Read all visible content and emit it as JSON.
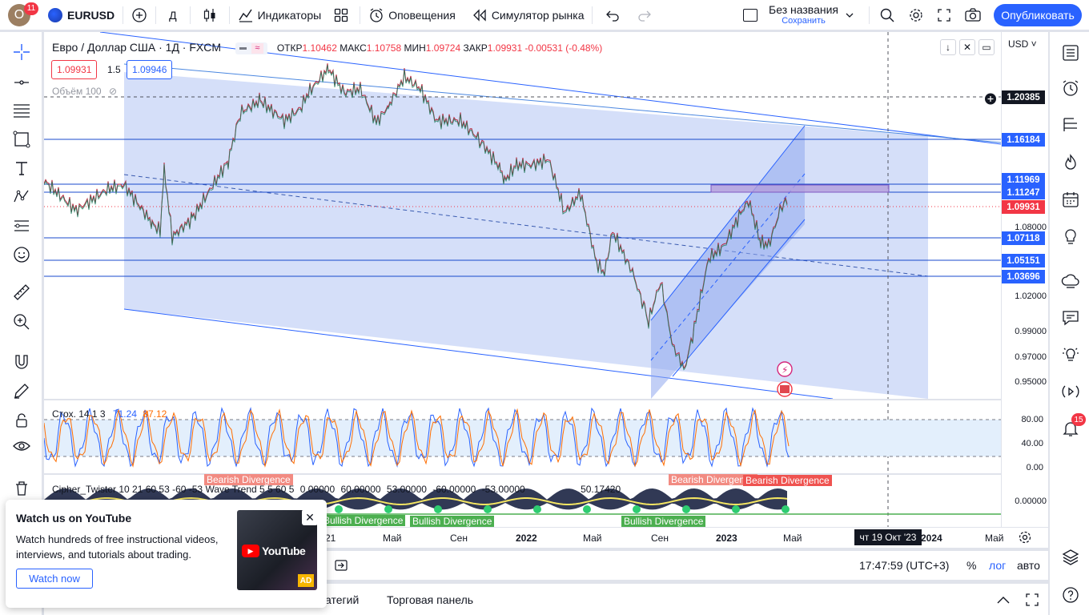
{
  "topbar": {
    "avatar_letter": "O",
    "avatar_badge": "11",
    "symbol": "EURUSD",
    "interval": "Д",
    "indicators_label": "Индикаторы",
    "alerts_label": "Оповещения",
    "replay_label": "Симулятор рынка",
    "layout_name": "Без названия",
    "layout_status": "Сохранить",
    "publish_label": "Опубликовать"
  },
  "legend": {
    "title": "Евро / Доллар США · 1Д · FXCM",
    "open_key": "ОТКР",
    "open": "1.10462",
    "high_key": "МАКС",
    "high": "1.10758",
    "low_key": "МИН",
    "low": "1.09724",
    "close_key": "ЗАКР",
    "close": "1.09931",
    "change": "-0.00531 (-0.48%)",
    "bid": "1.09931",
    "spread": "1.5",
    "ask": "1.09946",
    "volume_label": "Объём 100"
  },
  "scale": {
    "currency": "USD",
    "labels": [
      "1.08000",
      "1.02000",
      "0.99000",
      "0.97000",
      "0.95000"
    ],
    "badges": [
      {
        "value": "1.20385",
        "color": "#131722"
      },
      {
        "value": "1.16184",
        "color": "#2962ff"
      },
      {
        "value": "1.11969",
        "color": "#2962ff"
      },
      {
        "value": "1.11247",
        "color": "#2962ff"
      },
      {
        "value": "1.09931",
        "color": "#f23645"
      },
      {
        "value": "1.07118",
        "color": "#2962ff"
      },
      {
        "value": "1.05151",
        "color": "#2962ff"
      },
      {
        "value": "1.03696",
        "color": "#2962ff"
      }
    ],
    "stoch_labels": [
      "80.00",
      "40.00",
      "0.00"
    ],
    "cipher_label": "0.00000"
  },
  "stoch": {
    "label": "Стох. 14 1 3",
    "k": "71.24",
    "d": "87.12"
  },
  "cipher": {
    "label": "Cipher_Twister 10 21 60 53 -60 -53 Wave Trend 5 5 60 5",
    "vals": [
      "0.00000",
      "60.00000",
      "53.00000",
      "-60.00000",
      "-53.00000"
    ],
    "last": "50.17420",
    "bearish": "Bearish Divergence",
    "bullish": "Bullish Divergence"
  },
  "time_axis": {
    "labels": [
      "21",
      "Май",
      "Сен",
      "2022",
      "Май",
      "Сен",
      "2023",
      "Май",
      "2024",
      "Май"
    ],
    "cursor": "чт 19 Окт '23"
  },
  "bottom": {
    "clock": "17:47:59 (UTC+3)",
    "percent": "%",
    "log": "лог",
    "auto": "авто",
    "tab_strategy": "атегий",
    "tab_trading": "Торговая панель"
  },
  "youtube": {
    "title": "Watch us on YouTube",
    "text": "Watch hundreds of free instructional videos, interviews, and tutorials about trading.",
    "button": "Watch now",
    "logo": "YouTube",
    "ad": "AD"
  },
  "rightbar": {
    "badge": "15"
  },
  "colors": {
    "accent": "#2962ff",
    "down": "#f23645",
    "up": "#089981",
    "channel_fill": "#c7d4f7"
  }
}
